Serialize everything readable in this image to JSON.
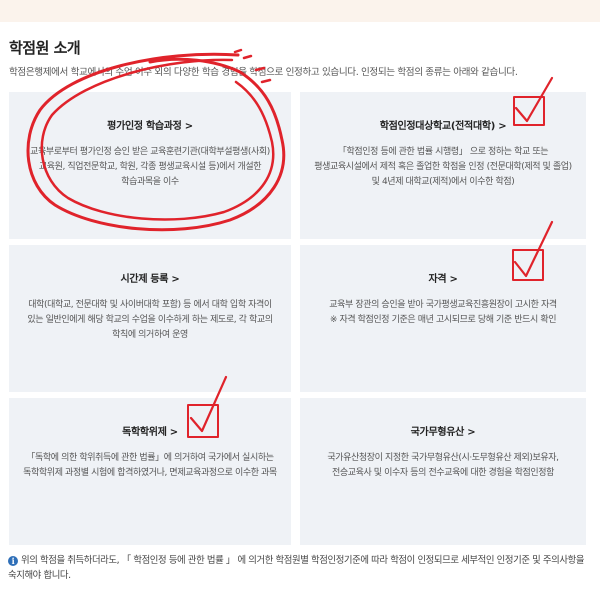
{
  "page": {
    "title": "학점원 소개",
    "intro": "학점은행제에서 학교에서의 수업 이수 외의 다양한 학습 경험을 학점으로 인정하고 있습니다. 인정되는 학점의 종류는 아래와 같습니다."
  },
  "cards": [
    {
      "title": "평가인정 학습과정 >",
      "desc": "교육부로부터 평가인정 승인 받은 교육훈련기관(대학부설평생(사회)교육원, 직업전문학교, 학원, 각종 평생교육시설 등)에서 개설한 학습과목을 이수"
    },
    {
      "title": "학점인정대상학교(전적대학) >",
      "desc": "「학점인정 등에 관한 법률 시행령」 으로 정하는 학교 또는 평생교육시설에서 제적 혹은 졸업한 학점을 인정 (전문대학(제적 및 졸업) 및 4년제 대학교(제적)에서 이수한 학점)"
    },
    {
      "title": "시간제 등록 >",
      "desc": "대학(대학교, 전문대학 및 사이버대학 포함) 등 에서 대학 입학 자격이 있는 일반인에게 해당 학교의 수업을 이수하게 하는 제도로, 각 학교의 학칙에 의거하여 운영"
    },
    {
      "title": "자격 >",
      "desc": "교육부 장관의 승인을 받아 국가평생교육진흥원장이 고시한 자격",
      "note": "※ 자격 학점인정 기준은 매년 고시되므로 당해 기준 반드시 확인"
    },
    {
      "title": "독학학위제 >",
      "desc": "「독학에 의한 학위취득에 관한 법률」에 의거하여 국가에서 실시하는 독학학위제 과정별 시험에 합격하였거나, 면제교육과정으로 이수한 과목"
    },
    {
      "title": "국가무형유산 >",
      "desc": "국가유산청장이 지정한 국가무형유산(시·도무형유산 제외)보유자, 전승교육사 및 이수자 등의 전수교육에 대한 경험을 학점인정함"
    }
  ],
  "notice": {
    "icon": "info-icon",
    "text": "위의 학점을 취득하더라도, 「 학점인정 등에 관한 법률 」 에 의거한 학점원별 학점인정기준에 따라 학점이 인정되므로 세부적인 인정기준 및 주의사항을 숙지해야 합니다."
  },
  "colors": {
    "card_bg": "#eff2f6",
    "annotation": "#e0232b",
    "info": "#2f6fb8"
  }
}
